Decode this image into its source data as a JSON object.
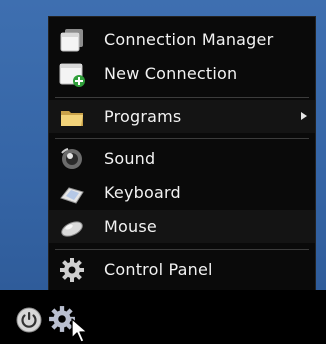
{
  "menu": {
    "items": [
      {
        "label": "Connection Manager",
        "icon": "connection-manager-icon"
      },
      {
        "label": "New Connection",
        "icon": "new-connection-icon"
      },
      {
        "label": "Programs",
        "icon": "folder-icon",
        "has_submenu": true
      },
      {
        "label": "Sound",
        "icon": "speaker-icon"
      },
      {
        "label": "Keyboard",
        "icon": "keyboard-icon"
      },
      {
        "label": "Mouse",
        "icon": "mouse-icon"
      },
      {
        "label": "Control Panel",
        "icon": "gear-icon"
      }
    ]
  },
  "taskbar": {
    "items": [
      {
        "icon": "power-icon"
      },
      {
        "icon": "gear-icon"
      }
    ]
  },
  "colors": {
    "desktop": "#3a68a8",
    "menu_background": "#0a0a0a",
    "menu_text": "#f2f2f2",
    "taskbar": "#000000"
  }
}
